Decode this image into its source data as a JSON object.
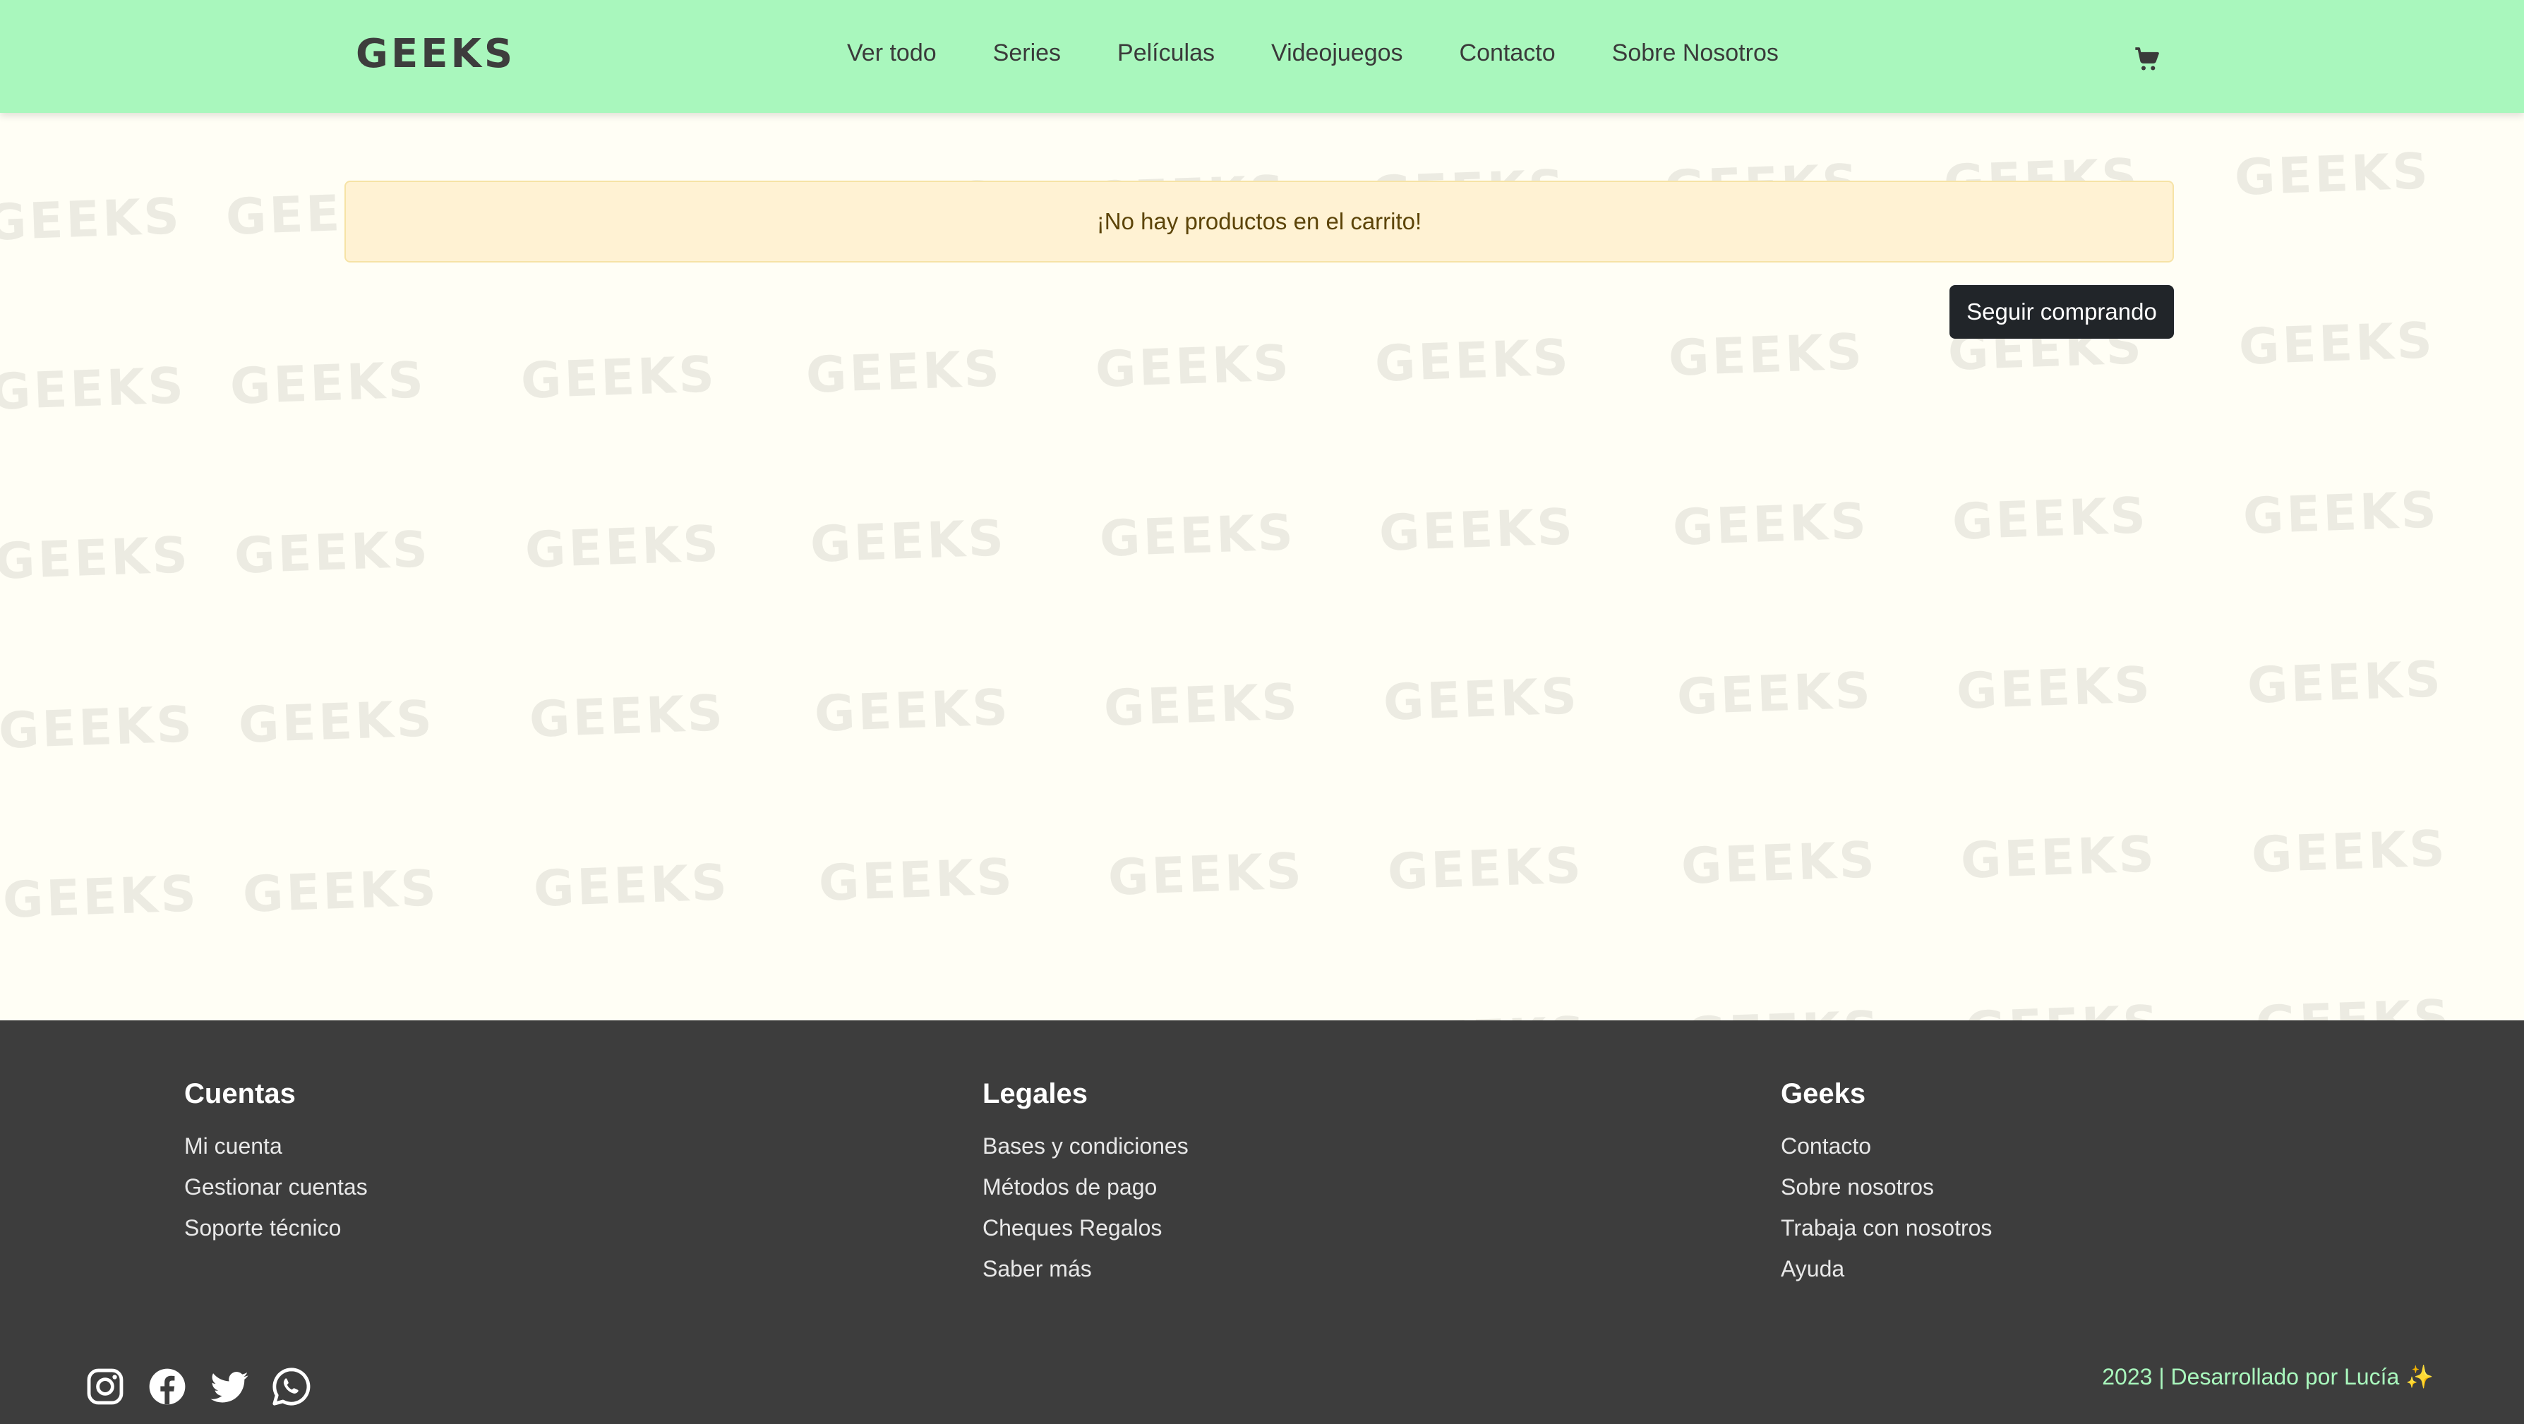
{
  "brand": {
    "logo_text": "GEEKS",
    "accent_color": "#a9f7bd"
  },
  "nav": {
    "items": [
      {
        "label": "Ver todo"
      },
      {
        "label": "Series"
      },
      {
        "label": "Películas"
      },
      {
        "label": "Videojuegos"
      },
      {
        "label": "Contacto"
      },
      {
        "label": "Sobre Nosotros"
      }
    ],
    "cart_icon": "shopping-cart-icon"
  },
  "main": {
    "alert_text": "¡No hay productos en el carrito!",
    "continue_button": "Seguir comprando",
    "watermark_text": "GEEKS"
  },
  "footer": {
    "columns": [
      {
        "title": "Cuentas",
        "links": [
          "Mi cuenta",
          "Gestionar cuentas",
          "Soporte técnico"
        ]
      },
      {
        "title": "Legales",
        "links": [
          "Bases y condiciones",
          "Métodos de pago",
          "Cheques Regalos",
          "Saber más"
        ]
      },
      {
        "title": "Geeks",
        "links": [
          "Contacto",
          "Sobre nosotros",
          "Trabaja con nosotros",
          "Ayuda"
        ]
      }
    ],
    "socials": [
      "instagram-icon",
      "facebook-icon",
      "twitter-icon",
      "whatsapp-icon"
    ],
    "credits": "2023 | Desarrollado por Lucía ✨"
  }
}
